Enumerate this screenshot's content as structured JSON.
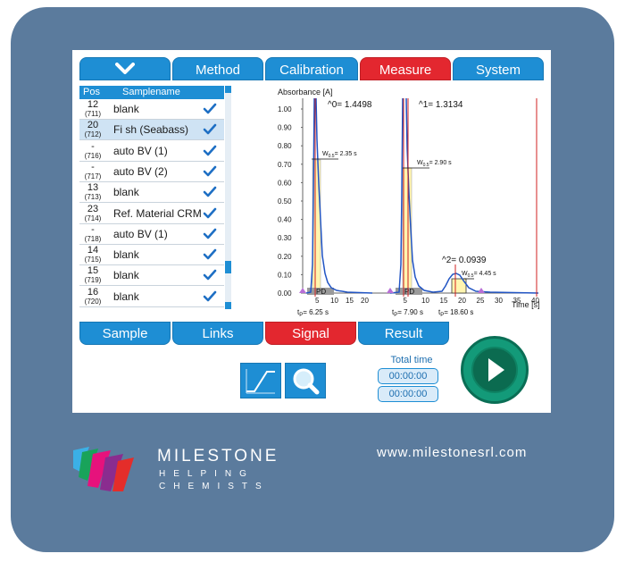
{
  "tabs": {
    "method": "Method",
    "calibration": "Calibration",
    "measure": "Measure",
    "system": "System"
  },
  "list": {
    "headers": {
      "pos": "Pos",
      "samplename": "Samplename"
    },
    "rows": [
      {
        "pos": "12",
        "sub": "(711)",
        "name": "blank"
      },
      {
        "pos": "20",
        "sub": "(712)",
        "name": "Fi sh (Seabass)"
      },
      {
        "pos": "-",
        "sub": "(716)",
        "name": "auto BV (1)"
      },
      {
        "pos": "-",
        "sub": "(717)",
        "name": "auto BV (2)"
      },
      {
        "pos": "13",
        "sub": "(713)",
        "name": "blank"
      },
      {
        "pos": "23",
        "sub": "(714)",
        "name": "Ref. Material CRM"
      },
      {
        "pos": "-",
        "sub": "(718)",
        "name": "auto BV (1)"
      },
      {
        "pos": "14",
        "sub": "(715)",
        "name": "blank"
      },
      {
        "pos": "15",
        "sub": "(719)",
        "name": "blank"
      },
      {
        "pos": "16",
        "sub": "(720)",
        "name": "blank"
      }
    ]
  },
  "chart_data": {
    "type": "line",
    "ylabel": "Absorbance [A]",
    "xlabel": "Time [s]",
    "yticks": [
      "1.00",
      "0.90",
      "0.80",
      "0.70",
      "0.60",
      "0.50",
      "0.40",
      "0.30",
      "0.20",
      "0.10",
      "0.00"
    ],
    "segment1_xticks": [
      "5",
      "10",
      "15",
      "20"
    ],
    "segment2_xticks": [
      "5",
      "10",
      "15",
      "20",
      "25",
      "30",
      "35",
      "40"
    ],
    "ylim": [
      0,
      1.05
    ],
    "peaks": [
      {
        "label": "^0= 1.4498",
        "w_label": "W",
        "w_sub": "0.5",
        "w_value": "= 2.35 s",
        "t_label": "t",
        "t_sub": "P",
        "t_value": "= 6.25 s",
        "pd": "PD"
      },
      {
        "label": "^1= 1.3134",
        "w_label": "W",
        "w_sub": "0.5",
        "w_value": "= 2.90 s",
        "t_label": "t",
        "t_sub": "P",
        "t_value": "= 7.90 s",
        "pd": "PD"
      },
      {
        "label": "^2= 0.0939",
        "w_label": "W",
        "w_sub": "0.5",
        "w_value": "= 4.45 s",
        "t_label": "t",
        "t_sub": "P",
        "t_value": "= 18.60 s"
      }
    ]
  },
  "bottom_tabs": {
    "sample": "Sample",
    "links": "Links",
    "signal": "Signal",
    "result": "Result"
  },
  "total_time": {
    "label": "Total time",
    "value1": "00:00:00",
    "value2": "00:00:00"
  },
  "branding": {
    "name": "MILESTONE",
    "tagline1": "HELPING",
    "tagline2": "CHEMISTS",
    "url": "www.milestonesrl.com"
  },
  "colors": {
    "accent": "#1e8ed4",
    "active": "#e3272f",
    "play": "#139a79",
    "frame": "#5b7b9d"
  }
}
